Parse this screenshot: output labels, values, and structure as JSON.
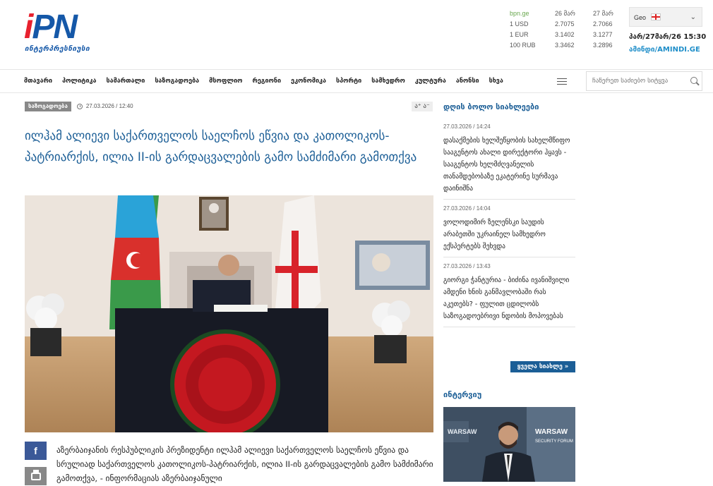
{
  "logo": {
    "main_i": "i",
    "main_pn": "PN",
    "sub": "ინტერპრესნიუსი"
  },
  "rates": {
    "source": "bpn.ge",
    "col1": "26 მარ",
    "col2": "27 მარ",
    "rows": [
      {
        "currency": "1 USD",
        "v1": "2.7075",
        "v2": "2.7066"
      },
      {
        "currency": "1 EUR",
        "v1": "3.1402",
        "v2": "3.1277"
      },
      {
        "currency": "100 RUB",
        "v1": "3.3462",
        "v2": "3.2896"
      }
    ]
  },
  "language": {
    "selected": "Geo",
    "icon": "georgian-flag-icon"
  },
  "datetime": "პარ/27მარ/26 15:30",
  "weather_link": "ამინდი/AMINDI.GE",
  "nav": {
    "items": [
      "მთავარი",
      "პოლიტიკა",
      "სამართალი",
      "საზოგადოება",
      "მსოფლიო",
      "რეგიონი",
      "ეკონომიკა",
      "სპორტი",
      "სამხედრო",
      "კულტურა",
      "ანონსი",
      "სხვა"
    ],
    "search_placeholder": "ჩაწერეთ საძიებო სიტყვა"
  },
  "article": {
    "category": "საზოგადოება",
    "date": "27.03.2026 / 12:40",
    "font_size_label": "ა⁺ ა⁻",
    "headline": "ილჰამ ალიევი საქართველოს საელჩოს ეწვია და კათოლიკოს-პატრიარქის, ილია II-ის გარდაცვალების გამო სამძიმარი გამოთქვა",
    "body": "აზერბაიჯანის რესპუბლიკის პრეზიდენტი ილჰამ ალიევი საქართველოს საელჩოს ეწვია და სრულიად საქართველოს კათოლიკოს-პატრიარქის, ილია II-ის გარდაცვალების გამო სამძიმარი გამოთქვა, - ინფორმაციას აზერბაიჯანული",
    "share_facebook": "f"
  },
  "sidebar": {
    "title": "დღის ბოლო სიახლეები",
    "items": [
      {
        "date": "27.03.2026 / 14:24",
        "text": "დასაქმების ხელშეწყობის სახელმწიფო სააგენტოს ახალი დირექტორი ჰყავს - სააგენტოს ხელმძღვანელის თანამდებობაზე ეკატერინე სურმავა დაინიშნა"
      },
      {
        "date": "27.03.2026 / 14:04",
        "text": "ვოლოდიმირ ზელენსკი საუდის არაბეთში უკრაინელ სამხედრო ექსპერტებს შეხვდა"
      },
      {
        "date": "27.03.2026 / 13:43",
        "text": "გიორგი ჭანტურია - ბიძინა ივანიშვილი ამდენი ხნის განმავლობაში რას აკეთებს? - ფულით ცდილობს საზოგადოებრივი ნდობის მოპოვებას"
      }
    ],
    "all_news": "ყველა სიახლე »",
    "interview_title": "ინტერვიუ",
    "interview_banner": "WARSAW SECURITY FORUM"
  }
}
